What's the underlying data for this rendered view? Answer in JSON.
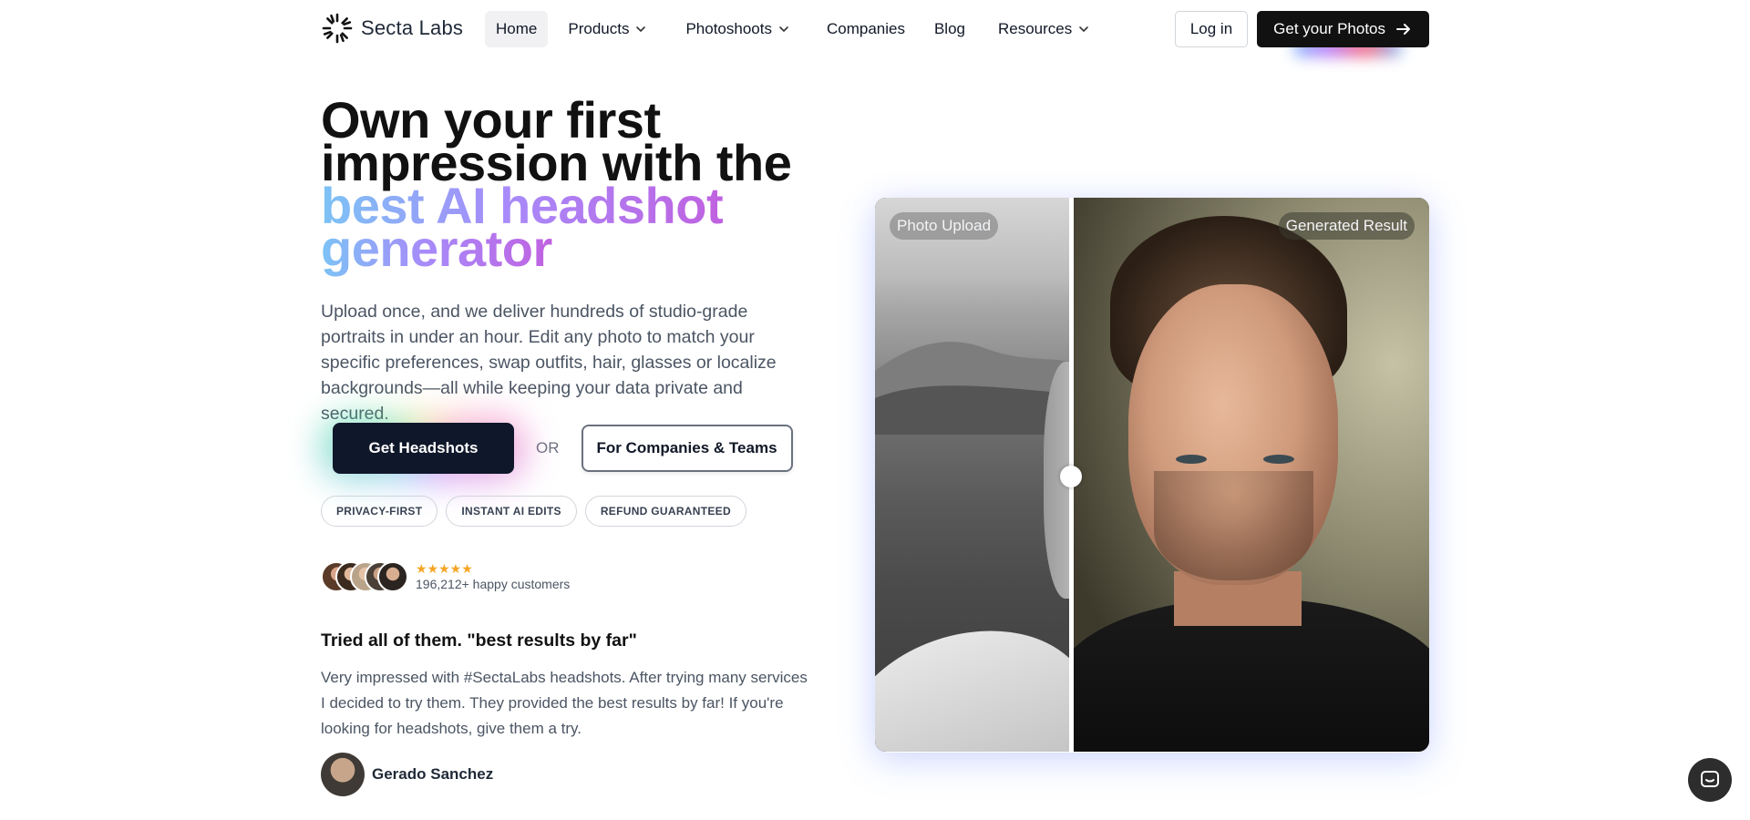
{
  "nav": {
    "brand": "Secta Labs",
    "links": [
      {
        "label": "Home",
        "has_menu": false,
        "active": true
      },
      {
        "label": "Products",
        "has_menu": true
      },
      {
        "label": "Photoshoots",
        "has_menu": true
      },
      {
        "label": "Companies",
        "has_menu": false
      },
      {
        "label": "Blog",
        "has_menu": false
      },
      {
        "label": "Resources",
        "has_menu": true
      }
    ],
    "login_label": "Log in",
    "cta_label": "Get your Photos"
  },
  "hero": {
    "title_line1": "Own your first",
    "title_line2": "impression with the",
    "title_highlight_line1": "best AI headshot",
    "title_highlight_line2": "generator",
    "description": "Upload once, and we deliver hundreds of studio-grade portraits in under an hour. Edit any photo to match your specific preferences, swap outfits, hair, glasses or localize backgrounds—all while keeping your data private and secured.",
    "primary_cta": "Get Headshots",
    "or_text": "OR",
    "secondary_cta": "For Companies & Teams",
    "pills": [
      "PRIVACY-FIRST",
      "INSTANT AI EDITS",
      "REFUND GUARANTEED"
    ]
  },
  "social_proof": {
    "stars": "★★★★★",
    "rating_value": 5,
    "customers_text": "196,212+ happy customers"
  },
  "testimonial": {
    "title": "Tried all of them. \"best results by far\"",
    "body": "Very impressed with #SectaLabs headshots. After trying many services I decided to try them. They provided the best results by far! If you're looking for headshots, give them a try.",
    "author": "Gerado Sanchez"
  },
  "comparison": {
    "before_label": "Photo Upload",
    "after_label": "Generated Result"
  },
  "colors": {
    "primary_dark": "#0f172a",
    "gradient_start": "#7cc3f5",
    "gradient_mid": "#a78bfa",
    "gradient_end": "#c061e0",
    "star": "#f5a524"
  },
  "icons": {
    "brand": "sunburst-logo-icon",
    "menu_chevron": "chevron-down-icon",
    "cta_arrow": "arrow-right-icon",
    "chat": "chat-bubble-icon"
  }
}
